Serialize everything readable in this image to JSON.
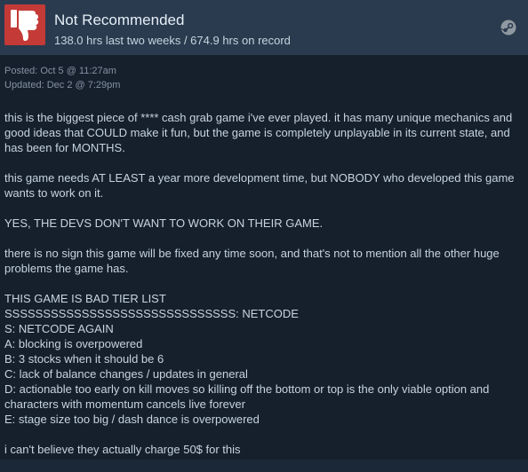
{
  "review": {
    "rating": "Not Recommended",
    "hours": "138.0 hrs last two weeks / 674.9 hrs on record",
    "posted": "Posted: Oct 5 @ 11:27am",
    "updated": "Updated: Dec 2 @ 7:29pm",
    "icons": {
      "rating": "thumbs-down-icon",
      "platform": "steam-icon"
    },
    "colors": {
      "thumb_bg": "#c43a36",
      "header_bg": "#2a3b4f",
      "body_bg": "#16202d",
      "text": "#c6d4df",
      "muted": "#8491a1"
    },
    "paragraphs": [
      "this is the biggest piece of **** cash grab game i've ever played. it has many unique mechanics and good ideas that COULD make it fun, but the game is completely unplayable in its current state, and has been for MONTHS.",
      "this game needs AT LEAST a year more development time, but NOBODY who developed this game wants to work on it.",
      "YES, THE DEVS DON'T WANT TO WORK ON THEIR GAME.",
      "there is no sign this game will be fixed any time soon, and that's not to mention all the other huge problems the game has."
    ],
    "tier_list": {
      "title": "THIS GAME IS BAD TIER LIST",
      "lines": [
        "SSSSSSSSSSSSSSSSSSSSSSSSSSSSSS: NETCODE",
        "S: NETCODE AGAIN",
        "A: blocking is overpowered",
        "B: 3 stocks when it should be 6",
        "C: lack of balance changes / updates in general",
        "D: actionable too early on kill moves so killing off the bottom or top is the only viable option and characters with momentum cancels live forever",
        "E: stage size too big / dash dance is overpowered"
      ]
    },
    "closing": "i can't believe they actually charge 50$ for this"
  }
}
